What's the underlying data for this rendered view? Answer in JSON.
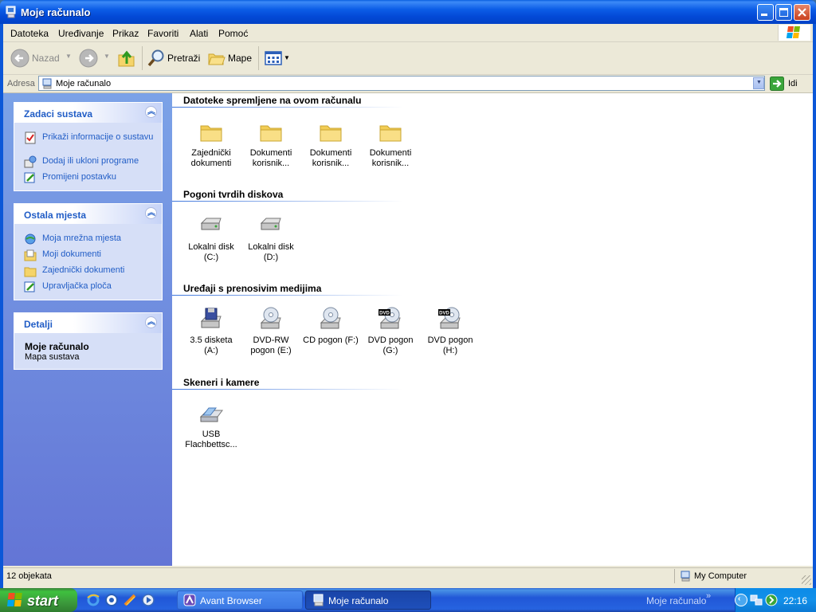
{
  "window": {
    "title": "Moje računalo"
  },
  "menu": [
    "Datoteka",
    "Uređivanje",
    "Prikaz",
    "Favoriti",
    "Alati",
    "Pomoć"
  ],
  "toolbar": {
    "back_label": "Nazad",
    "search_label": "Pretraži",
    "folders_label": "Mape"
  },
  "address": {
    "label": "Adresa",
    "value": "Moje računalo",
    "go_label": "Idi"
  },
  "left_panel": {
    "system_tasks": {
      "title": "Zadaci sustava",
      "items": [
        "Prikaži informacije o sustavu",
        "Dodaj ili ukloni programe",
        "Promijeni postavku"
      ]
    },
    "other_places": {
      "title": "Ostala mjesta",
      "items": [
        "Moja mrežna mjesta",
        "Moji dokumenti",
        "Zajednički dokumenti",
        "Upravljačka ploča"
      ]
    },
    "details": {
      "title": "Detalji",
      "name": "Moje računalo",
      "desc": "Mapa sustava"
    }
  },
  "groups": {
    "files": {
      "title": "Datoteke spremljene na ovom računalu",
      "items": [
        {
          "line1": "Zajednički",
          "line2": "dokumenti"
        },
        {
          "line1": "Dokumenti",
          "line2": "korisnik..."
        },
        {
          "line1": "Dokumenti",
          "line2": "korisnik..."
        },
        {
          "line1": "Dokumenti",
          "line2": "korisnik..."
        }
      ]
    },
    "drives": {
      "title": "Pogoni tvrdih diskova",
      "items": [
        {
          "line1": "Lokalni disk",
          "line2": "(C:)"
        },
        {
          "line1": "Lokalni disk",
          "line2": "(D:)"
        }
      ]
    },
    "removable": {
      "title": "Uređaji s prenosivim medijima",
      "items": [
        {
          "line1": "3.5 disketa",
          "line2": "(A:)"
        },
        {
          "line1": "DVD-RW",
          "line2": "pogon (E:)"
        },
        {
          "line1": "CD pogon (F:)",
          "line2": ""
        },
        {
          "line1": "DVD pogon",
          "line2": "(G:)"
        },
        {
          "line1": "DVD pogon",
          "line2": "(H:)"
        }
      ],
      "dvd_badge": "DVD"
    },
    "scanners": {
      "title": "Skeneri i kamere",
      "items": [
        {
          "line1": "USB",
          "line2": "Flachbettsc..."
        }
      ]
    }
  },
  "status": {
    "count": "12 objekata",
    "zone": "My Computer"
  },
  "taskbar": {
    "start_label": "start",
    "buttons": [
      "Avant Browser",
      "Moje računalo"
    ],
    "toolbar_label": "Moje računalo",
    "clock": "22:16"
  }
}
